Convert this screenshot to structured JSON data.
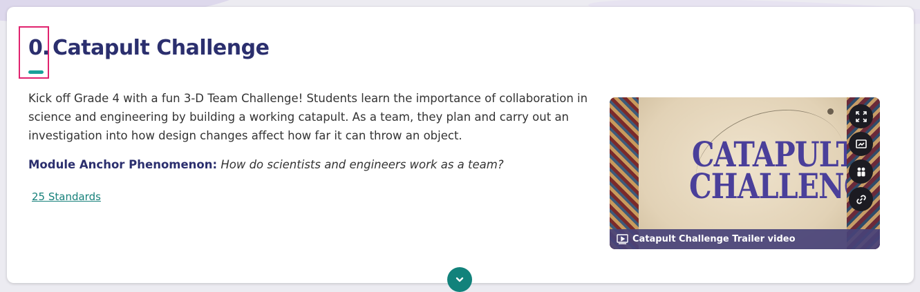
{
  "module": {
    "number": "0.",
    "title": "Catapult Challenge",
    "description": "Kick off Grade 4 with a fun 3-D Team Challenge! Students learn the importance of collaboration in science and engineering by building a working catapult. As a team, they plan and carry out an investigation into how design changes affect how far it can throw an object.",
    "anchor_label": "Module Anchor Phenomenon:",
    "anchor_text": "How do scientists and engineers work as a team?",
    "standards_link": "25 Standards"
  },
  "video": {
    "art_title_line1": "CATAPULT",
    "art_title_line2": "CHALLENGE!",
    "caption": "Catapult Challenge Trailer video",
    "tools": [
      "fullscreen-icon",
      "presentation-icon",
      "group-icon",
      "link-icon"
    ]
  },
  "colors": {
    "title": "#2b2f6e",
    "accent": "#19a19a",
    "highlight_box": "#e0226e",
    "link": "#16807a",
    "caption_bar": "#484278"
  }
}
